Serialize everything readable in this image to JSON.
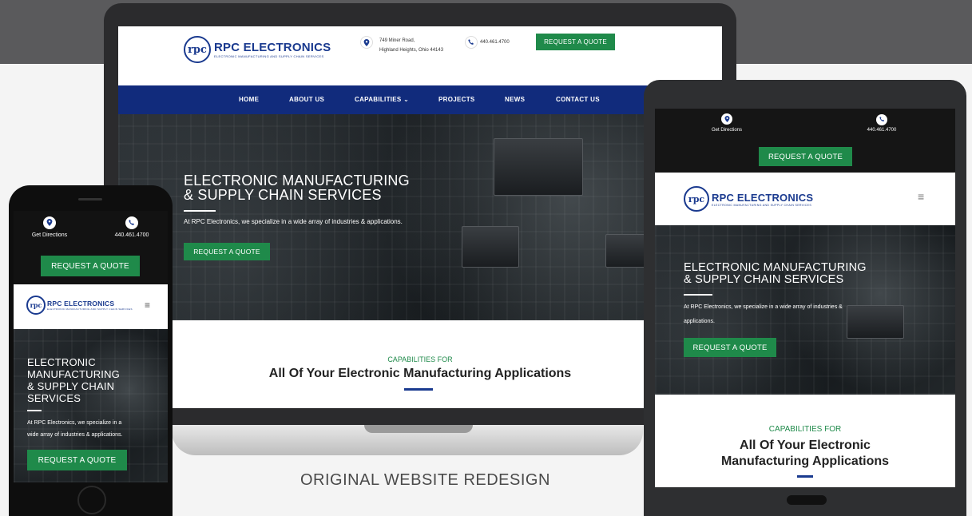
{
  "caption": "ORIGINAL WEBSITE REDESIGN",
  "brand": {
    "mark": "rpc",
    "name": "RPC ELECTRONICS",
    "tagline": "ELECTRONIC MANUFACTURING AND SUPPLY CHAIN SERVICES"
  },
  "colors": {
    "navy": "#112b7c",
    "green": "#1f8a4a",
    "brand_blue": "#1a3a8f"
  },
  "contact": {
    "address_line1": "749 Miner Road,",
    "address_line2": "Highland Heights, Ohio 44143",
    "phone": "440.461.4700",
    "directions_label": "Get Directions"
  },
  "cta": {
    "label": "REQUEST A QUOTE"
  },
  "nav": {
    "items": [
      "HOME",
      "ABOUT US",
      "CAPABILITIES ⌄",
      "PROJECTS",
      "NEWS",
      "CONTACT US"
    ]
  },
  "hero": {
    "title_line1": "ELECTRONIC MANUFACTURING",
    "title_line2": "& SUPPLY CHAIN SERVICES",
    "phone_title": [
      "ELECTRONIC",
      "MANUFACTURING",
      "& SUPPLY CHAIN",
      "SERVICES"
    ],
    "text": "At RPC Electronics, we specialize in a wide array of industries & applications.",
    "text_split": [
      "At RPC Electronics, we specialize in a",
      "wide array of industries & applications."
    ],
    "tablet_text_split": [
      "At RPC Electronics, we specialize in a wide array of industries &",
      "applications."
    ]
  },
  "capabilities": {
    "label": "CAPABILITIES FOR",
    "title": "All Of Your Electronic Manufacturing Applications",
    "title_line1": "All Of Your Electronic",
    "title_line2": "Manufacturing Applications"
  },
  "icons": {
    "location": "location-pin-icon",
    "phone": "phone-icon",
    "menu": "hamburger-menu-icon"
  }
}
